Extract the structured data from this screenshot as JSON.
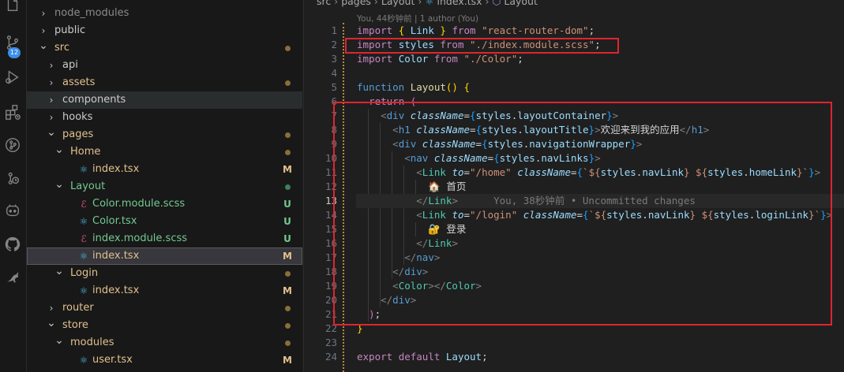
{
  "activity_bar": {
    "icons": [
      "files-icon",
      "source-control-icon",
      "run-debug-icon",
      "extensions-icon",
      "git-graph-icon",
      "remote-explorer-icon",
      "copilot-icon",
      "github-icon",
      "kangaroo-icon"
    ],
    "source_control_badge": "12"
  },
  "explorer": {
    "rows": [
      {
        "label": "node_modules",
        "kind": "folder",
        "open": false,
        "depth": 1,
        "color": "#8b8b8b",
        "status": ""
      },
      {
        "label": "public",
        "kind": "folder",
        "open": false,
        "depth": 1,
        "color": "#cccccc",
        "status": ""
      },
      {
        "label": "src",
        "kind": "folder",
        "open": true,
        "depth": 1,
        "color": "#e2c08d",
        "status": "dot",
        "status_color": "#8a6d3b"
      },
      {
        "label": "api",
        "kind": "folder",
        "open": false,
        "depth": 2,
        "color": "#cccccc",
        "status": ""
      },
      {
        "label": "assets",
        "kind": "folder",
        "open": false,
        "depth": 2,
        "color": "#e2c08d",
        "status": "dot",
        "status_color": "#8a6d3b"
      },
      {
        "label": "components",
        "kind": "folder",
        "open": false,
        "depth": 2,
        "color": "#cccccc",
        "status": "",
        "hover": true
      },
      {
        "label": "hooks",
        "kind": "folder",
        "open": false,
        "depth": 2,
        "color": "#cccccc",
        "status": ""
      },
      {
        "label": "pages",
        "kind": "folder",
        "open": true,
        "depth": 2,
        "color": "#e2c08d",
        "status": "dot",
        "status_color": "#8a6d3b"
      },
      {
        "label": "Home",
        "kind": "folder",
        "open": true,
        "depth": 3,
        "color": "#e2c08d",
        "status": "dot",
        "status_color": "#8a6d3b"
      },
      {
        "label": "index.tsx",
        "kind": "tsx",
        "depth": 4,
        "color": "#e2c08d",
        "status": "M",
        "status_color": "#e2c08d"
      },
      {
        "label": "Layout",
        "kind": "folder",
        "open": true,
        "depth": 3,
        "color": "#73c991",
        "status": "dot",
        "status_color": "#3f7f5a"
      },
      {
        "label": "Color.module.scss",
        "kind": "scss",
        "depth": 4,
        "color": "#73c991",
        "status": "U",
        "status_color": "#73c991"
      },
      {
        "label": "Color.tsx",
        "kind": "tsx",
        "depth": 4,
        "color": "#73c991",
        "status": "U",
        "status_color": "#73c991"
      },
      {
        "label": "index.module.scss",
        "kind": "scss",
        "depth": 4,
        "color": "#73c991",
        "status": "U",
        "status_color": "#73c991"
      },
      {
        "label": "index.tsx",
        "kind": "tsx",
        "depth": 4,
        "color": "#e2c08d",
        "status": "M",
        "status_color": "#e2c08d",
        "selected": true
      },
      {
        "label": "Login",
        "kind": "folder",
        "open": true,
        "depth": 3,
        "color": "#e2c08d",
        "status": "dot",
        "status_color": "#8a6d3b"
      },
      {
        "label": "index.tsx",
        "kind": "tsx",
        "depth": 4,
        "color": "#e2c08d",
        "status": "M",
        "status_color": "#e2c08d"
      },
      {
        "label": "router",
        "kind": "folder",
        "open": false,
        "depth": 2,
        "color": "#e2c08d",
        "status": "dot",
        "status_color": "#8a6d3b"
      },
      {
        "label": "store",
        "kind": "folder",
        "open": true,
        "depth": 2,
        "color": "#e2c08d",
        "status": "dot",
        "status_color": "#8a6d3b"
      },
      {
        "label": "modules",
        "kind": "folder",
        "open": true,
        "depth": 3,
        "color": "#e2c08d",
        "status": "dot",
        "status_color": "#8a6d3b"
      },
      {
        "label": "user.tsx",
        "kind": "tsx",
        "depth": 4,
        "color": "#e2c08d",
        "status": "M",
        "status_color": "#e2c08d"
      }
    ]
  },
  "editor": {
    "breadcrumb": [
      "src",
      "pages",
      "Layout",
      "index.tsx",
      "Layout"
    ],
    "blame_header": "You, 44秒钟前 | 1 author (You)",
    "active_line": 13,
    "lines": [
      {
        "no": "1",
        "tokens": [
          [
            "kw",
            "import "
          ],
          [
            "br",
            "{ "
          ],
          [
            "var",
            "Link "
          ],
          [
            "br",
            "} "
          ],
          [
            "kw",
            "from "
          ],
          [
            "str",
            "\"react-router-dom\""
          ],
          [
            "txt",
            ";"
          ]
        ]
      },
      {
        "no": "2",
        "tokens": [
          [
            "kw",
            "import "
          ],
          [
            "var",
            "styles "
          ],
          [
            "kw",
            "from "
          ],
          [
            "str",
            "\"./index.module.scss\""
          ],
          [
            "txt",
            ";"
          ]
        ]
      },
      {
        "no": "3",
        "tokens": [
          [
            "kw",
            "import "
          ],
          [
            "var",
            "Color "
          ],
          [
            "kw",
            "from "
          ],
          [
            "str",
            "\"./Color\""
          ],
          [
            "txt",
            ";"
          ]
        ]
      },
      {
        "no": "4",
        "tokens": []
      },
      {
        "no": "5",
        "tokens": [
          [
            "kw2",
            "function "
          ],
          [
            "fn",
            "Layout"
          ],
          [
            "br",
            "() {"
          ]
        ]
      },
      {
        "no": "6",
        "tokens": [
          [
            "txt",
            "  "
          ],
          [
            "kw",
            "return "
          ],
          [
            "br2",
            "("
          ]
        ]
      },
      {
        "no": "7",
        "tokens": [
          [
            "txt",
            "    "
          ],
          [
            "punc",
            "<"
          ],
          [
            "tag",
            "div "
          ],
          [
            "attr",
            "className"
          ],
          [
            "txt",
            "="
          ],
          [
            "br3",
            "{"
          ],
          [
            "var",
            "styles"
          ],
          [
            "txt",
            "."
          ],
          [
            "var",
            "layoutContainer"
          ],
          [
            "br3",
            "}"
          ],
          [
            "punc",
            ">"
          ]
        ]
      },
      {
        "no": "8",
        "tokens": [
          [
            "txt",
            "      "
          ],
          [
            "punc",
            "<"
          ],
          [
            "tag",
            "h1 "
          ],
          [
            "attr",
            "className"
          ],
          [
            "txt",
            "="
          ],
          [
            "br3",
            "{"
          ],
          [
            "var",
            "styles"
          ],
          [
            "txt",
            "."
          ],
          [
            "var",
            "layoutTitle"
          ],
          [
            "br3",
            "}"
          ],
          [
            "punc",
            ">"
          ],
          [
            "txt",
            "欢迎来到我的应用"
          ],
          [
            "punc",
            "</"
          ],
          [
            "tag",
            "h1"
          ],
          [
            "punc",
            ">"
          ]
        ]
      },
      {
        "no": "9",
        "tokens": [
          [
            "txt",
            "      "
          ],
          [
            "punc",
            "<"
          ],
          [
            "tag",
            "div "
          ],
          [
            "attr",
            "className"
          ],
          [
            "txt",
            "="
          ],
          [
            "br3",
            "{"
          ],
          [
            "var",
            "styles"
          ],
          [
            "txt",
            "."
          ],
          [
            "var",
            "navigationWrapper"
          ],
          [
            "br3",
            "}"
          ],
          [
            "punc",
            ">"
          ]
        ]
      },
      {
        "no": "10",
        "tokens": [
          [
            "txt",
            "        "
          ],
          [
            "punc",
            "<"
          ],
          [
            "tag",
            "nav "
          ],
          [
            "attr",
            "className"
          ],
          [
            "txt",
            "="
          ],
          [
            "br3",
            "{"
          ],
          [
            "var",
            "styles"
          ],
          [
            "txt",
            "."
          ],
          [
            "var",
            "navLinks"
          ],
          [
            "br3",
            "}"
          ],
          [
            "punc",
            ">"
          ]
        ]
      },
      {
        "no": "11",
        "tokens": [
          [
            "txt",
            "          "
          ],
          [
            "punc",
            "<"
          ],
          [
            "cmp",
            "Link "
          ],
          [
            "attr",
            "to"
          ],
          [
            "txt",
            "="
          ],
          [
            "str",
            "\"/home\" "
          ],
          [
            "attr",
            "className"
          ],
          [
            "txt",
            "="
          ],
          [
            "br3",
            "{"
          ],
          [
            "str",
            "`${"
          ],
          [
            "var",
            "styles"
          ],
          [
            "txt",
            "."
          ],
          [
            "var",
            "navLink"
          ],
          [
            "str",
            "} ${"
          ],
          [
            "var",
            "styles"
          ],
          [
            "txt",
            "."
          ],
          [
            "var",
            "homeLink"
          ],
          [
            "str",
            "}`"
          ],
          [
            "br3",
            "}"
          ],
          [
            "punc",
            ">"
          ]
        ]
      },
      {
        "no": "12",
        "tokens": [
          [
            "txt",
            "            🏠 首页"
          ]
        ]
      },
      {
        "no": "13",
        "tokens": [
          [
            "txt",
            "          "
          ],
          [
            "punc",
            "</"
          ],
          [
            "cmp",
            "Link"
          ],
          [
            "punc",
            ">"
          ],
          [
            "blame",
            "      You, 38秒钟前 • Uncommitted changes"
          ]
        ]
      },
      {
        "no": "14",
        "tokens": [
          [
            "txt",
            "          "
          ],
          [
            "punc",
            "<"
          ],
          [
            "cmp",
            "Link "
          ],
          [
            "attr",
            "to"
          ],
          [
            "txt",
            "="
          ],
          [
            "str",
            "\"/login\" "
          ],
          [
            "attr",
            "className"
          ],
          [
            "txt",
            "="
          ],
          [
            "br3",
            "{"
          ],
          [
            "str",
            "`${"
          ],
          [
            "var",
            "styles"
          ],
          [
            "txt",
            "."
          ],
          [
            "var",
            "navLink"
          ],
          [
            "str",
            "} ${"
          ],
          [
            "var",
            "styles"
          ],
          [
            "txt",
            "."
          ],
          [
            "var",
            "loginLink"
          ],
          [
            "str",
            "}`"
          ],
          [
            "br3",
            "}"
          ],
          [
            "punc",
            ">"
          ]
        ]
      },
      {
        "no": "15",
        "tokens": [
          [
            "txt",
            "            🔐 登录"
          ]
        ]
      },
      {
        "no": "16",
        "tokens": [
          [
            "txt",
            "          "
          ],
          [
            "punc",
            "</"
          ],
          [
            "cmp",
            "Link"
          ],
          [
            "punc",
            ">"
          ]
        ]
      },
      {
        "no": "17",
        "tokens": [
          [
            "txt",
            "        "
          ],
          [
            "punc",
            "</"
          ],
          [
            "tag",
            "nav"
          ],
          [
            "punc",
            ">"
          ]
        ]
      },
      {
        "no": "18",
        "tokens": [
          [
            "txt",
            "      "
          ],
          [
            "punc",
            "</"
          ],
          [
            "tag",
            "div"
          ],
          [
            "punc",
            ">"
          ]
        ]
      },
      {
        "no": "19",
        "tokens": [
          [
            "txt",
            "      "
          ],
          [
            "punc",
            "<"
          ],
          [
            "cmp",
            "Color"
          ],
          [
            "punc",
            "></"
          ],
          [
            "cmp",
            "Color"
          ],
          [
            "punc",
            ">"
          ]
        ]
      },
      {
        "no": "20",
        "tokens": [
          [
            "txt",
            "    "
          ],
          [
            "punc",
            "</"
          ],
          [
            "tag",
            "div"
          ],
          [
            "punc",
            ">"
          ]
        ]
      },
      {
        "no": "21",
        "tokens": [
          [
            "txt",
            "  "
          ],
          [
            "br2",
            ")"
          ],
          [
            "txt",
            ";"
          ]
        ]
      },
      {
        "no": "22",
        "tokens": [
          [
            "br",
            "}"
          ]
        ]
      },
      {
        "no": "23",
        "tokens": []
      },
      {
        "no": "24",
        "tokens": [
          [
            "kw",
            "export "
          ],
          [
            "kw",
            "default "
          ],
          [
            "var",
            "Layout"
          ],
          [
            "txt",
            ";"
          ]
        ]
      }
    ]
  }
}
